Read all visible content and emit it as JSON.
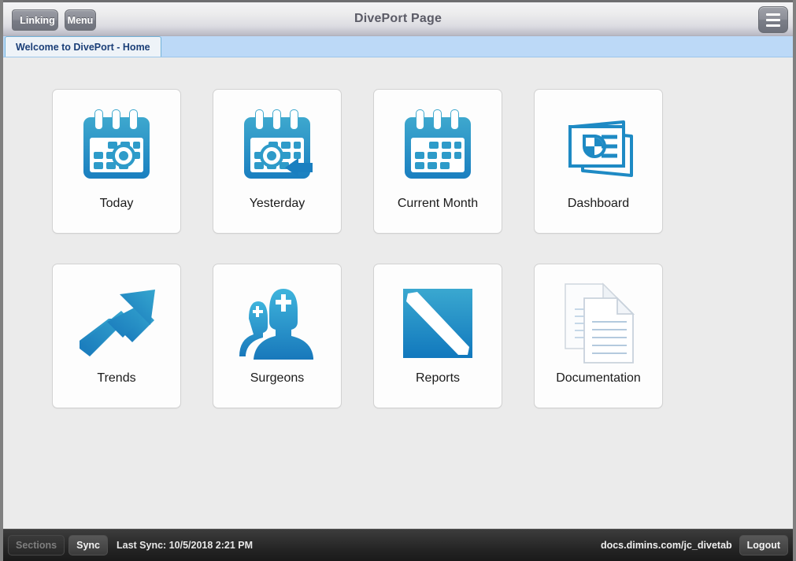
{
  "window": {
    "title": "DivePort Page"
  },
  "titlebar": {
    "linking_label": "Linking",
    "menu_label": "Menu",
    "hamburger_icon": "hamburger-menu-icon"
  },
  "tabs": [
    {
      "label": "Welcome to DivePort - Home",
      "active": true
    }
  ],
  "tiles": [
    {
      "label": "Today",
      "icon": "calendar-today-icon"
    },
    {
      "label": "Yesterday",
      "icon": "calendar-yesterday-arrow-icon"
    },
    {
      "label": "Current Month",
      "icon": "calendar-month-icon"
    },
    {
      "label": "Dashboard",
      "icon": "dashboard-cards-pie-icon"
    },
    {
      "label": "Trends",
      "icon": "trend-up-arrow-icon"
    },
    {
      "label": "Surgeons",
      "icon": "surgeons-people-icon"
    },
    {
      "label": "Reports",
      "icon": "reports-square-icon"
    },
    {
      "label": "Documentation",
      "icon": "documents-pages-icon"
    }
  ],
  "footer": {
    "sections_label": "Sections",
    "sync_label": "Sync",
    "last_sync": "Last Sync: 10/5/2018 2:21 PM",
    "url": "docs.dimins.com/jc_divetab",
    "logout_label": "Logout"
  },
  "colors": {
    "accent_blue": "#2e9bc9",
    "accent_blue_dark": "#1a7fc0",
    "tab_strip": "#bcd9f7",
    "tab_text": "#1b3f78",
    "page_background": "#ebebeb",
    "tile_background": "#fdfdfd",
    "footer_background": "#2a2a2a",
    "title_text": "#5b5b66"
  }
}
